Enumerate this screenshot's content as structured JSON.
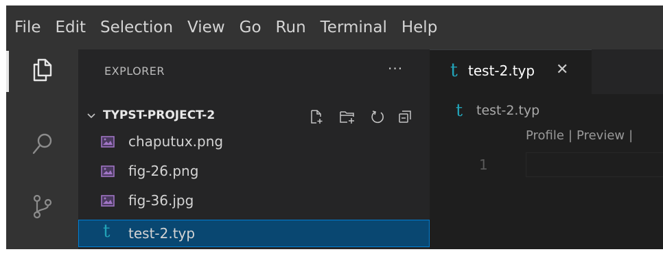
{
  "menubar": {
    "items": [
      "File",
      "Edit",
      "Selection",
      "View",
      "Go",
      "Run",
      "Terminal",
      "Help"
    ]
  },
  "activitybar": {
    "items": [
      {
        "icon": "files-icon",
        "active": true
      },
      {
        "icon": "search-icon",
        "active": false
      },
      {
        "icon": "source-control-icon",
        "active": false
      }
    ]
  },
  "sidebar": {
    "title": "EXPLORER",
    "more": "···",
    "project": {
      "name": "TYPST-PROJECT-2",
      "actions": [
        "new-file-icon",
        "new-folder-icon",
        "refresh-icon",
        "collapse-all-icon"
      ]
    },
    "files": [
      {
        "name": "chaputux.png",
        "icon": "image-file-icon",
        "selected": false
      },
      {
        "name": "fig-26.png",
        "icon": "image-file-icon",
        "selected": false
      },
      {
        "name": "fig-36.jpg",
        "icon": "image-file-icon",
        "selected": false
      },
      {
        "name": "test-2.typ",
        "icon": "typst-file-icon",
        "selected": true
      }
    ]
  },
  "editor": {
    "tab": {
      "glyph": "t",
      "label": "test-2.typ",
      "close": "✕"
    },
    "breadcrumb": {
      "glyph": "t",
      "label": "test-2.typ"
    },
    "codelens": {
      "profile": "Profile",
      "separator": "|",
      "preview": "Preview",
      "trailing": "|"
    },
    "line_number": "1"
  },
  "colors": {
    "typst_accent": "#22a3b8",
    "selection_bg": "#094771",
    "selection_border": "#007fd4"
  }
}
